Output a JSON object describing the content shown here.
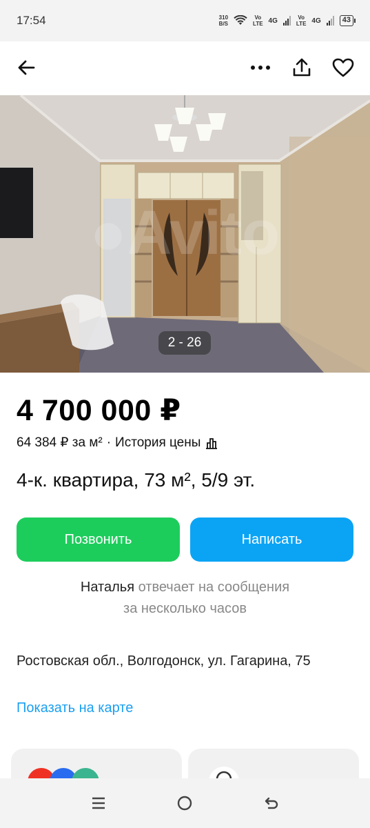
{
  "status": {
    "time": "17:54",
    "net_speed_top": "310",
    "net_speed_bottom": "B/S",
    "sim1_top": "Vo",
    "sim1_bottom": "LTE",
    "sim1_gen": "4G",
    "sim2_top": "Vo",
    "sim2_bottom": "LTE",
    "sim2_gen": "4G",
    "battery": "43"
  },
  "toolbar": {
    "back_icon": "arrow-left-icon",
    "more_icon": "more-dots-icon",
    "share_icon": "share-icon",
    "favorite_icon": "heart-icon"
  },
  "gallery": {
    "counter": "2 - 26"
  },
  "listing": {
    "price": "4 700 000 ₽",
    "price_per_m2": "64 384 ₽ за м²",
    "separator": "·",
    "price_history": "История цены",
    "title": "4-к. квартира, 73 м², 5/9 эт."
  },
  "actions": {
    "call": "Позвонить",
    "write": "Написать"
  },
  "seller": {
    "name": "Наталья",
    "response_line1": "отвечает на сообщения",
    "response_line2": "за несколько часов"
  },
  "location": {
    "address": "Ростовская обл., Волгодонск, ул. Гагарина, 75",
    "map_link": "Показать на карте"
  },
  "colors": {
    "call_button": "#1dcd5c",
    "write_button": "#0ba4f5",
    "link": "#1a9ff0"
  }
}
